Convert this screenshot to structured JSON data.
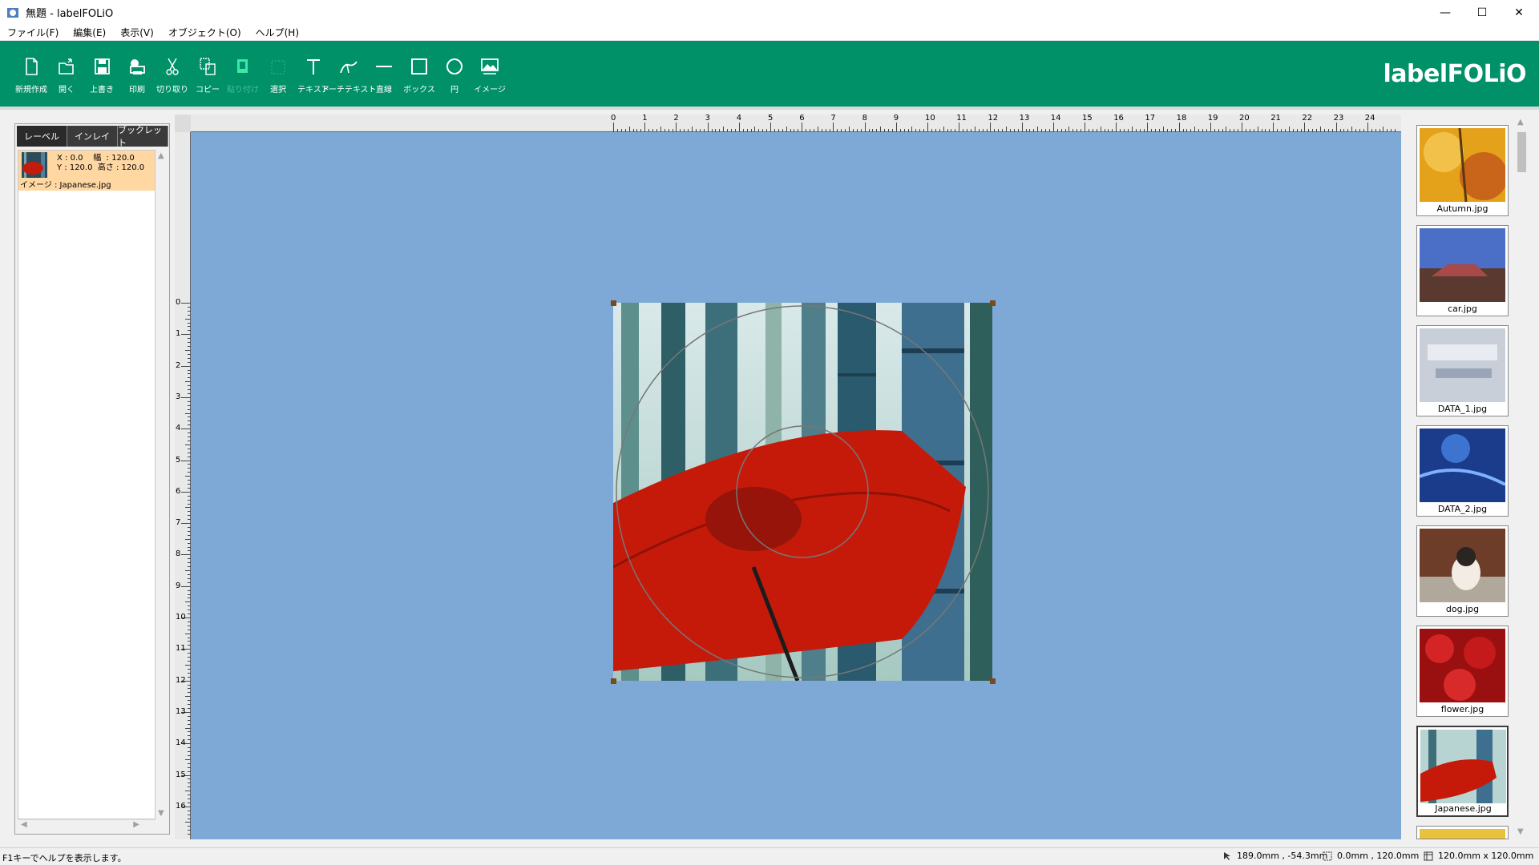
{
  "window": {
    "title": "無題 - labelFOLiO",
    "minimize": "—",
    "maximize": "☐",
    "close": "✕"
  },
  "menu": [
    {
      "label": "ファイル(F)"
    },
    {
      "label": "編集(E)"
    },
    {
      "label": "表示(V)"
    },
    {
      "label": "オブジェクト(O)"
    },
    {
      "label": "ヘルプ(H)"
    }
  ],
  "toolbar": {
    "brand": "labelFOLiO",
    "tools": [
      {
        "label": "新規作成",
        "icon": "new-file-icon"
      },
      {
        "label": "開く",
        "icon": "open-folder-icon"
      },
      {
        "label": "上書き",
        "icon": "save-icon"
      },
      {
        "label": "印刷",
        "icon": "print-icon"
      },
      {
        "label": "切り取り",
        "icon": "scissors-icon"
      },
      {
        "label": "コピー",
        "icon": "copy-icon"
      },
      {
        "label": "貼り付け",
        "icon": "paste-icon"
      },
      {
        "label": "選択",
        "icon": "select-icon"
      },
      {
        "label": "テキスト",
        "icon": "text-icon"
      },
      {
        "label": "アーチテキスト",
        "icon": "arch-text-icon"
      },
      {
        "label": "直線",
        "icon": "line-icon"
      },
      {
        "label": "ボックス",
        "icon": "box-icon"
      },
      {
        "label": "円",
        "icon": "circle-icon"
      },
      {
        "label": "イメージ",
        "icon": "image-icon"
      }
    ]
  },
  "left_panel": {
    "tabs": [
      {
        "label": "レーベル"
      },
      {
        "label": "インレイ"
      },
      {
        "label": "ブックレット"
      }
    ],
    "layers": [
      {
        "line1": "X : 0.0    幅  : 120.0",
        "line2": "Y : 120.0  高さ : 120.0",
        "name": "イメージ : Japanese.jpg"
      }
    ]
  },
  "ruler": {
    "h_labels": [
      "0",
      "1",
      "2",
      "3",
      "4",
      "5",
      "6",
      "7",
      "8",
      "9",
      "10",
      "11",
      "12",
      "13",
      "14",
      "15",
      "16",
      "17",
      "18",
      "19",
      "20",
      "21",
      "22",
      "23",
      "24"
    ],
    "v_labels": [
      "0",
      "1",
      "2",
      "3",
      "4",
      "5",
      "6",
      "7",
      "8",
      "9",
      "10",
      "11",
      "12",
      "13",
      "14",
      "15",
      "16"
    ]
  },
  "thumbnails": [
    {
      "caption": "Autumn.jpg"
    },
    {
      "caption": "car.jpg"
    },
    {
      "caption": "DATA_1.jpg"
    },
    {
      "caption": "DATA_2.jpg"
    },
    {
      "caption": "dog.jpg"
    },
    {
      "caption": "flower.jpg"
    },
    {
      "caption": "Japanese.jpg"
    }
  ],
  "status": {
    "help": "F1キーでヘルプを表示します。",
    "cursor": "189.0mm , -54.3mm",
    "position": "0.0mm , 120.0mm",
    "size": "120.0mm x 120.0mm"
  },
  "colors": {
    "toolbar": "#009168",
    "workspace": "#7ea8d6",
    "selected_layer": "#ffd7a3"
  }
}
